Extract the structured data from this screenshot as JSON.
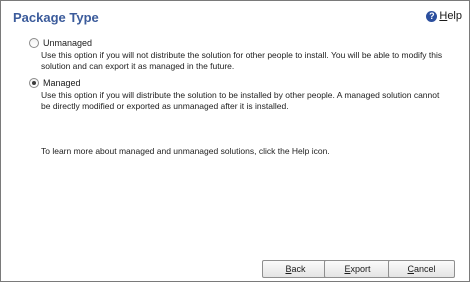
{
  "header": {
    "title": "Package Type",
    "help_label": "Help",
    "help_icon": "?"
  },
  "options": [
    {
      "label": "Unmanaged",
      "checked": false,
      "description": "Use this option if you will not distribute the solution for other people to install. You will be able to modify this solution and can export it as managed in the future."
    },
    {
      "label": "Managed",
      "checked": true,
      "description": "Use this option if you will distribute the solution to be installed by other people. A managed solution cannot be directly modified or exported as unmanaged after it is installed."
    }
  ],
  "help_text": "To learn more about managed and unmanaged solutions, click the Help icon.",
  "buttons": {
    "back": "Back",
    "export": "Export",
    "cancel": "Cancel"
  },
  "colors": {
    "title": "#3b5b9b",
    "help_icon": "#2b4f9e"
  }
}
